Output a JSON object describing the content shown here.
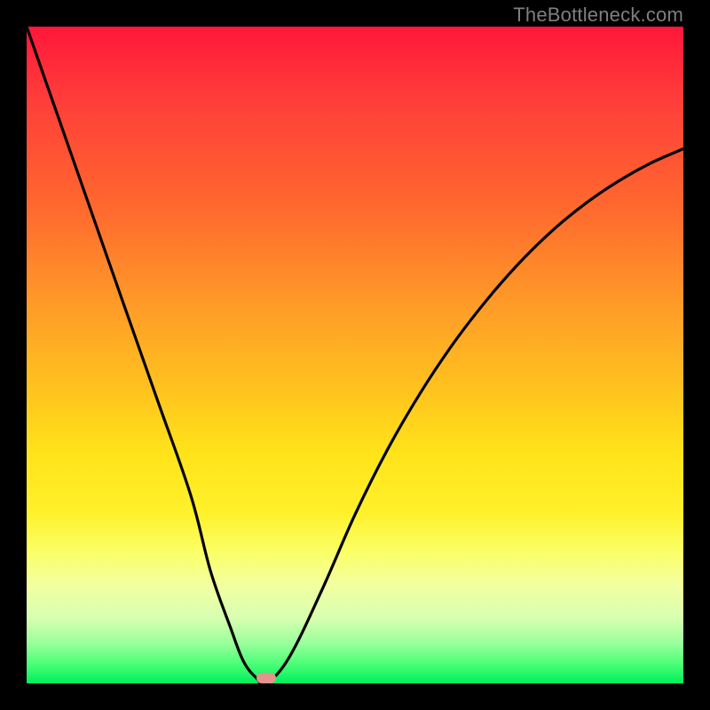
{
  "watermark": "TheBottleneck.com",
  "chart_data": {
    "type": "line",
    "title": "",
    "xlabel": "",
    "ylabel": "",
    "xlim": [
      0,
      100
    ],
    "ylim": [
      0,
      100
    ],
    "gradient_legend_note": "Background gradient: top = high bottleneck (red), bottom = low bottleneck (green)",
    "series": [
      {
        "name": "bottleneck-curve",
        "x": [
          0,
          5,
          10,
          15,
          20,
          25,
          28,
          31,
          33,
          35,
          36.5,
          40,
          45,
          50,
          55,
          60,
          65,
          70,
          75,
          80,
          85,
          90,
          95,
          100
        ],
        "values": [
          100,
          85.7,
          71.4,
          57.1,
          42.9,
          28.6,
          17.1,
          8.6,
          3.4,
          0.8,
          0,
          4.0,
          14.3,
          25.7,
          35.7,
          44.3,
          51.8,
          58.3,
          64.0,
          68.9,
          73.0,
          76.4,
          79.2,
          81.4
        ]
      }
    ],
    "marker": {
      "x": 36.5,
      "y": 0.8,
      "color": "#e5938d"
    }
  }
}
